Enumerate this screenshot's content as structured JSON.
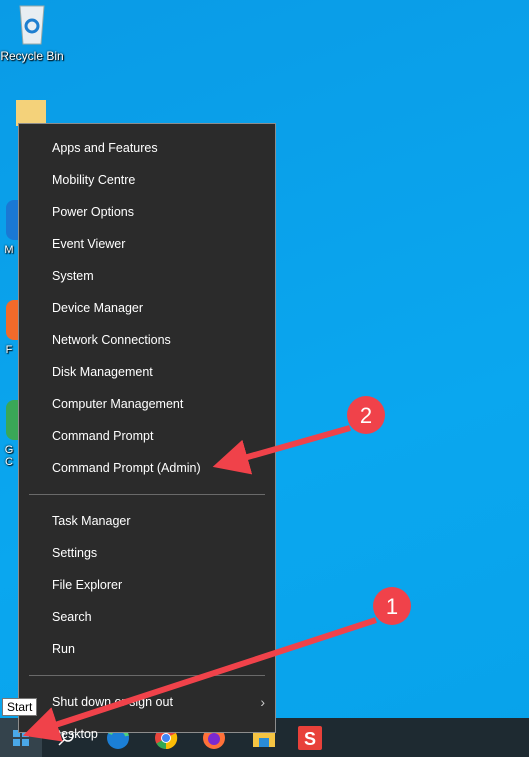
{
  "desktop": {
    "icons": [
      {
        "label": "Recycle Bin"
      },
      {
        "label": "M"
      },
      {
        "label": "F"
      },
      {
        "label": "G C"
      }
    ]
  },
  "menu": {
    "groups": [
      [
        "Apps and Features",
        "Mobility Centre",
        "Power Options",
        "Event Viewer",
        "System",
        "Device Manager",
        "Network Connections",
        "Disk Management",
        "Computer Management",
        "Command Prompt",
        "Command Prompt (Admin)"
      ],
      [
        "Task Manager",
        "Settings",
        "File Explorer",
        "Search",
        "Run"
      ],
      [
        "Shut down or sign out",
        "Desktop"
      ]
    ]
  },
  "tooltip": "Start",
  "annotations": {
    "step1": "1",
    "step2": "2",
    "color": "#f0424a"
  },
  "taskbar": {
    "icons": [
      "windows-start-icon",
      "search-icon",
      "edge-icon",
      "chrome-icon",
      "firefox-icon",
      "file-explorer-icon",
      "snagit-icon"
    ]
  }
}
